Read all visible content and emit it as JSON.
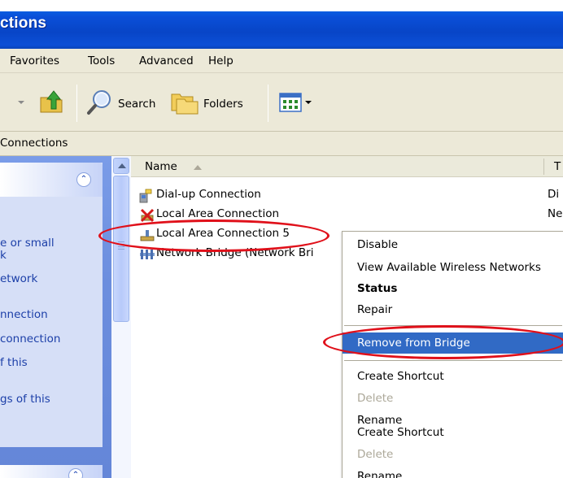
{
  "window": {
    "title_fragment": "ctions"
  },
  "menubar": {
    "items": [
      "Favorites",
      "Tools",
      "Advanced",
      "Help"
    ]
  },
  "toolbar": {
    "search_label": "Search",
    "folders_label": "Folders"
  },
  "address": {
    "text": "Connections"
  },
  "taskpane": {
    "links": [
      "e or small",
      "k",
      "etwork",
      "nnection",
      "connection",
      "f this",
      "gs of this"
    ]
  },
  "filelist": {
    "headers": {
      "name": "Name",
      "type": "T"
    },
    "rows": [
      {
        "name": "Dial-up Connection",
        "type": "Di",
        "icon": "dialup-icon"
      },
      {
        "name": "Local Area Connection",
        "type": "Ne",
        "icon": "lan-disabled-icon"
      },
      {
        "name": "Local Area Connection 5",
        "type": "",
        "icon": "lan-icon"
      },
      {
        "name": "Network Bridge (Network Bri",
        "type": "",
        "icon": "network-bridge-icon"
      }
    ]
  },
  "context_menu": {
    "items": [
      {
        "label": "Disable"
      },
      {
        "label": "View Available Wireless Networks"
      },
      {
        "label": "Status"
      },
      {
        "label": "Repair"
      },
      {
        "label": "Remove from Bridge"
      },
      {
        "label": "Create Shortcut"
      },
      {
        "label": "Delete"
      },
      {
        "label": "Rename"
      },
      {
        "label": "Create Shortcut"
      },
      {
        "label": "Delete"
      },
      {
        "label": "Rename"
      }
    ]
  },
  "colors": {
    "titlebar": "#0845c7",
    "menu_highlight": "#316ac5",
    "annotation_red": "#e0101a",
    "task_link": "#1c3fa8"
  }
}
